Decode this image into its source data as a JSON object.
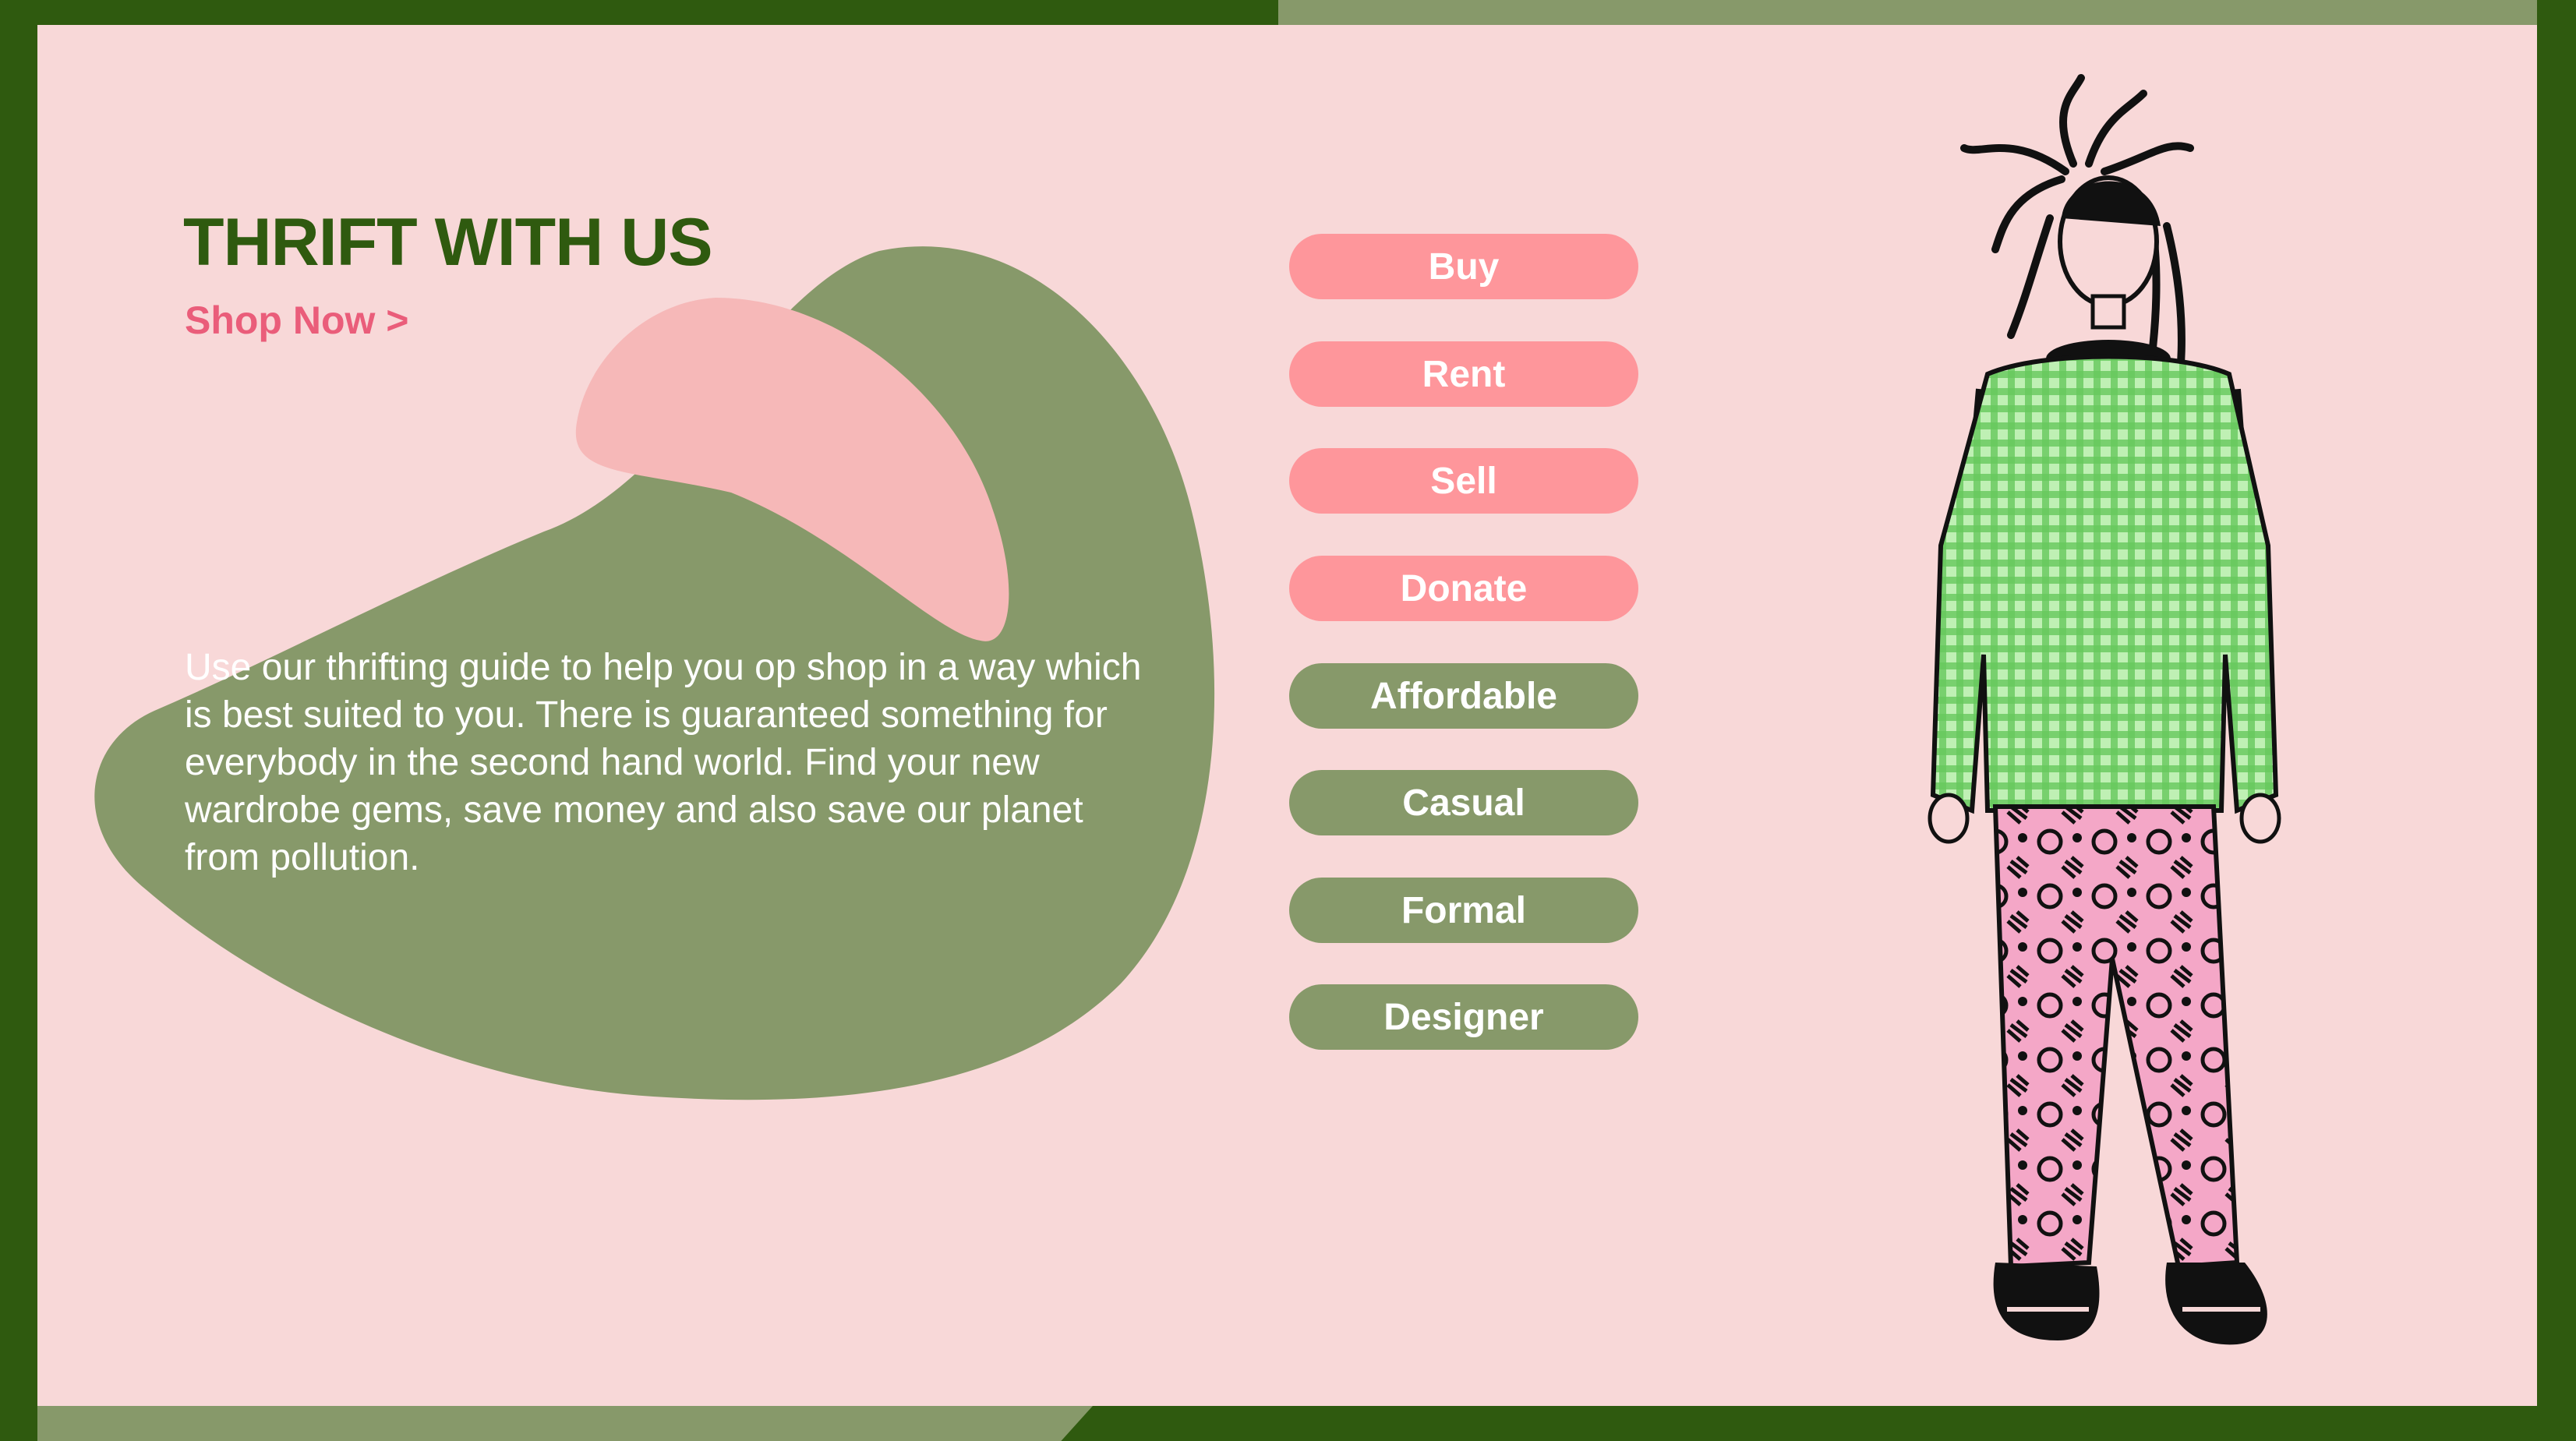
{
  "hero": {
    "title": "THRIFT WITH US",
    "shop_now": "Shop Now >",
    "blurb": "Use our thrifting guide to help you op shop in a way which is best suited to you. There is guaranteed something for everybody in the second hand world. Find your new wardrobe gems, save money and also save our planet from pollution."
  },
  "options": [
    {
      "label": "Buy",
      "style": "pink"
    },
    {
      "label": "Rent",
      "style": "pink"
    },
    {
      "label": "Sell",
      "style": "pink"
    },
    {
      "label": "Donate",
      "style": "pink"
    }
  ],
  "filters": [
    {
      "label": "Affordable",
      "style": "green"
    },
    {
      "label": "Casual",
      "style": "green"
    },
    {
      "label": "Formal",
      "style": "green"
    },
    {
      "label": "Designer",
      "style": "green"
    }
  ],
  "colors": {
    "frame": "#2f5a0f",
    "panel": "#f8d8d8",
    "sage": "#87996a",
    "pink_button": "#fe969b",
    "pink_blob": "#f6b8b8",
    "link_pink": "#ea5d7a"
  },
  "illustration": {
    "icon": "thrift-shopper-illustration-icon"
  }
}
